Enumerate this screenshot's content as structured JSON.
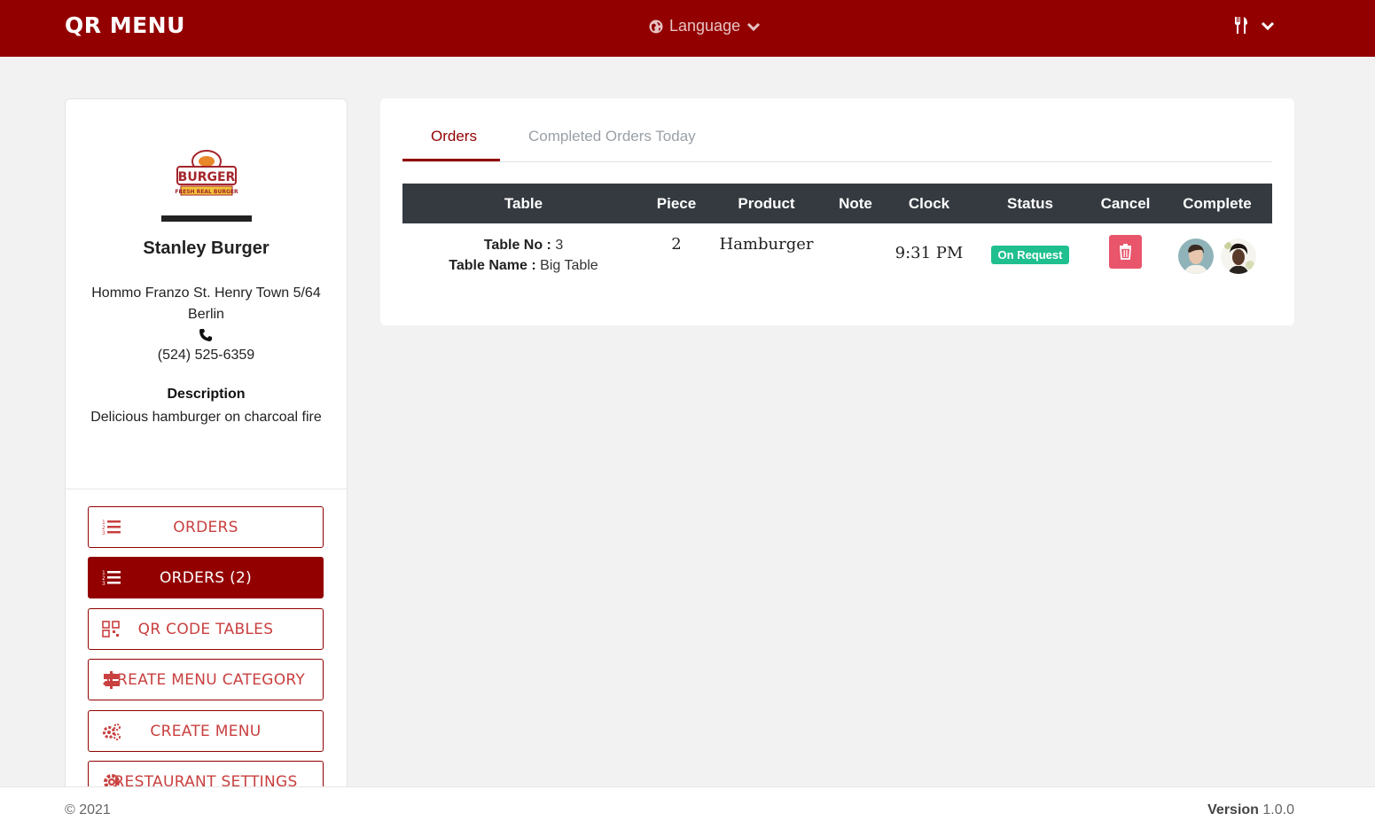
{
  "app": {
    "brand": "QR MENU"
  },
  "header": {
    "language_label": "Language"
  },
  "restaurant": {
    "logo_text_top": "BURGER",
    "logo_text_bottom": "FRESH REAL BURGER",
    "name": "Stanley Burger",
    "address": "Hommo Franzo St. Henry Town 5/64 Berlin",
    "phone": "(524) 525-6359",
    "description_title": "Description",
    "description": "Delicious hamburger on charcoal fire"
  },
  "sidebar": {
    "items": [
      {
        "label": "ORDERS",
        "icon": "list-ol-icon",
        "active": false
      },
      {
        "label": "ORDERS (2)",
        "icon": "list-ol-icon",
        "active": true
      },
      {
        "label": "QR CODE TABLES",
        "icon": "qrcode-icon",
        "active": false
      },
      {
        "label": "CREATE MENU CATEGORY",
        "icon": "signpost-icon",
        "active": false
      },
      {
        "label": "CREATE MENU",
        "icon": "cogs-icon",
        "active": false
      },
      {
        "label": "RESTAURANT SETTINGS",
        "icon": "gear-icon",
        "active": false
      }
    ]
  },
  "tabs": {
    "orders": "Orders",
    "completed": "Completed Orders Today"
  },
  "table": {
    "headers": [
      "Table",
      "Piece",
      "Product",
      "Note",
      "Clock",
      "Status",
      "Cancel",
      "Complete"
    ],
    "rows": [
      {
        "table_no_label": "Table No :",
        "table_no": "3",
        "table_name_label": "Table Name :",
        "table_name": "Big Table",
        "piece": "2",
        "product": "Hamburger",
        "note": "",
        "clock": "9:31 PM",
        "status": "On Request"
      }
    ]
  },
  "footer": {
    "copyright": "© 2021",
    "version_label": "Version",
    "version": "1.0.0"
  },
  "colors": {
    "brand": "#930000",
    "status": "#1fbf8f",
    "danger": "#e9556a",
    "table_header": "#343a40"
  }
}
